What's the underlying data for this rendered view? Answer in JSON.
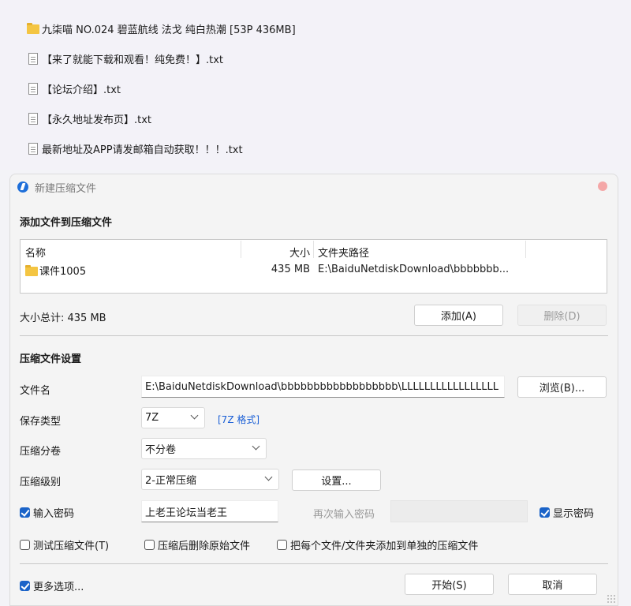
{
  "files": [
    {
      "type": "folder",
      "icon": "folder-icon",
      "name": "九柒喵 NO.024 碧蓝航线 法戈 纯白热潮 [53P 436MB]"
    },
    {
      "type": "txt",
      "icon": "text-file-icon",
      "name": "【来了就能下载和观看！纯免费！】.txt"
    },
    {
      "type": "txt",
      "icon": "text-file-icon",
      "name": "【论坛介绍】.txt"
    },
    {
      "type": "txt",
      "icon": "text-file-icon",
      "name": "【永久地址发布页】.txt"
    },
    {
      "type": "txt",
      "icon": "text-file-icon",
      "name": "最新地址及APP请发邮箱自动获取！！！.txt"
    }
  ],
  "dialog": {
    "title": "新建压缩文件",
    "add_section_title": "添加文件到压缩文件",
    "columns": {
      "name": "名称",
      "size": "大小",
      "path": "文件夹路径"
    },
    "rows": [
      {
        "icon": "folder-icon",
        "name": "课件1005",
        "size": "435 MB",
        "path": "E:\\BaiduNetdiskDownload\\bbbbbbb..."
      }
    ],
    "total_size": "大小总计: 435 MB",
    "add_button": "添加(A)",
    "delete_button": "删除(D)",
    "settings_section_title": "压缩文件设置",
    "filename_label": "文件名",
    "filename_value": "E:\\BaiduNetdiskDownload\\bbbbbbbbbbbbbbbbbb\\LLLLLLLLLLLLLLLLL",
    "browse_button": "浏览(B)...",
    "save_type_label": "保存类型",
    "save_type_value": "7Z",
    "save_type_hint": "[7Z 格式]",
    "split_label": "压缩分卷",
    "split_value": "不分卷",
    "level_label": "压缩级别",
    "level_value": "2-正常压缩",
    "settings_button": "设置...",
    "password_label": "输入密码",
    "password_checked": true,
    "password_value": "上老王论坛当老王",
    "password_repeat_label": "再次输入密码",
    "password_repeat_value": "",
    "show_password_label": "显示密码",
    "show_password_checked": true,
    "test_label": "测试压缩文件(T)",
    "test_checked": false,
    "delete_after_label": "压缩后删除原始文件",
    "delete_after_checked": false,
    "separate_label": "把每个文件/文件夹添加到单独的压缩文件",
    "separate_checked": false,
    "more_options_label": "更多选项...",
    "more_options_checked": true,
    "start_button": "开始(S)",
    "cancel_button": "取消"
  },
  "colors": {
    "accent": "#1a63c8",
    "link": "#1a5fd6",
    "close": "#f4a7a7",
    "folder": "#f4c542"
  }
}
